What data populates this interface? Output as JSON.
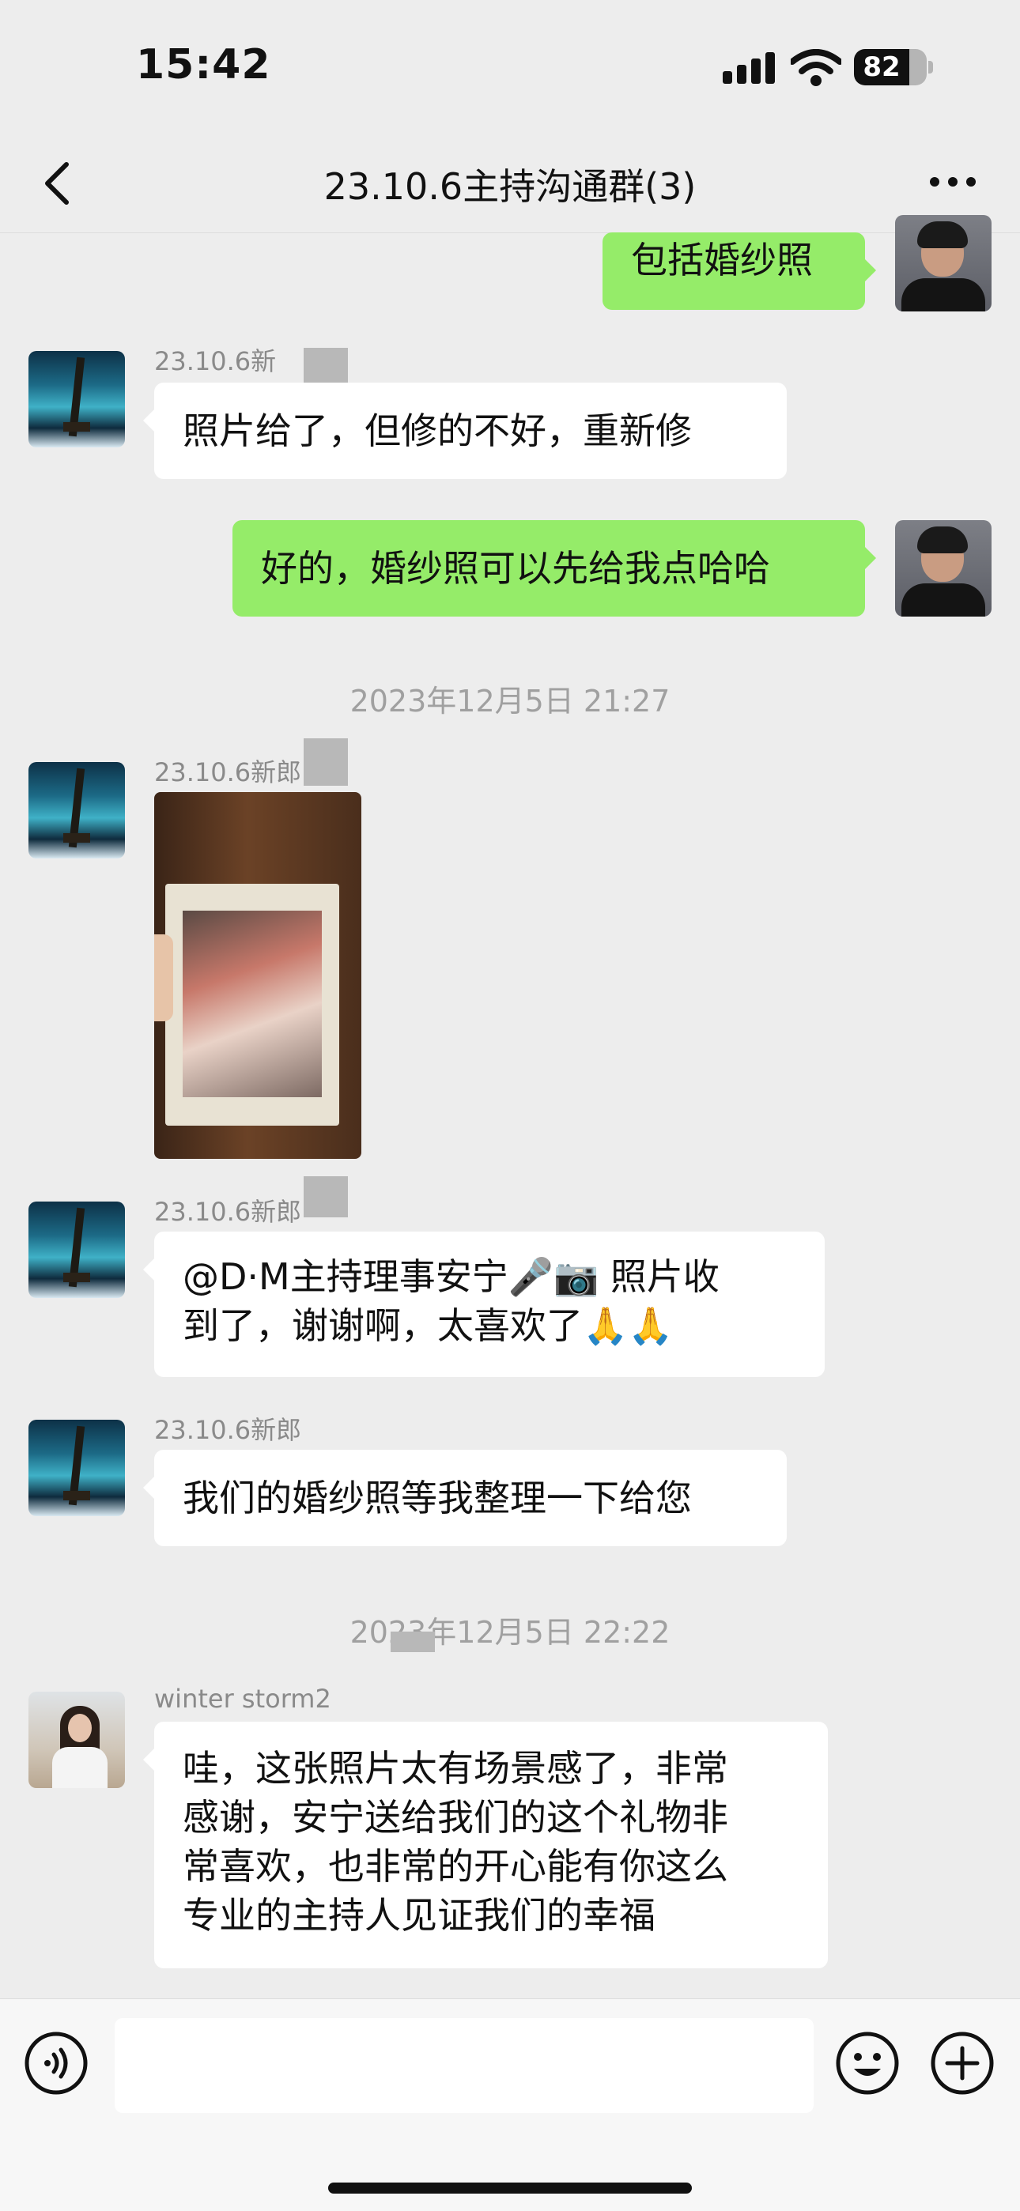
{
  "status_bar": {
    "time": "15:42",
    "battery": "82"
  },
  "header": {
    "title": "23.10.6主持沟通群(3)"
  },
  "messages": [
    {
      "text": "包括婚纱照"
    },
    {
      "sender": "23.10.6新",
      "text": "照片给了，但修的不好，重新修"
    },
    {
      "text": "好的，婚纱照可以先给我点哈哈"
    },
    {
      "timestamp": "2023年12月5日 21:27"
    },
    {
      "sender": "23.10.6新郎"
    },
    {
      "sender": "23.10.6新郎",
      "lines": [
        "@D·M主持理事安宁🎤📷 照片收",
        "到了，谢谢啊，太喜欢了🙏🙏"
      ]
    },
    {
      "sender": "23.10.6新郎",
      "text": "我们的婚纱照等我整理一下给您"
    },
    {
      "timestamp": "2023年12月5日 22:22"
    },
    {
      "sender": "winter storm2",
      "lines": [
        "哇，这张照片太有场景感了，非常",
        "感谢，安宁送给我们的这个礼物非",
        "常喜欢，也非常的开心能有你这么",
        "专业的主持人见证我们的幸福"
      ]
    }
  ],
  "input": {
    "placeholder": ""
  }
}
